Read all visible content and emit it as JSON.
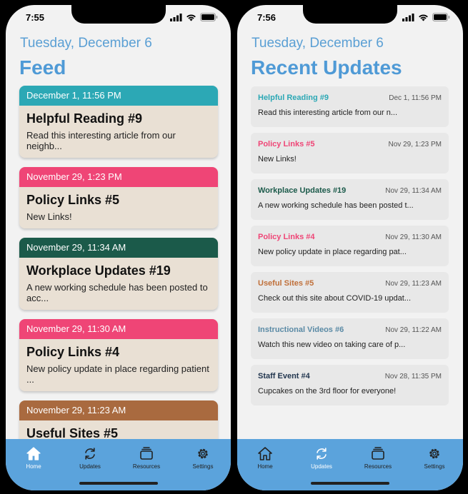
{
  "left": {
    "time": "7:55",
    "date": "Tuesday, December 6",
    "title": "Feed",
    "cards": [
      {
        "date": "December 1, 11:56 PM",
        "title": "Helpful Reading #9",
        "text": "Read this interesting article from our neighb...",
        "color": "#2ca8b5"
      },
      {
        "date": "November 29, 1:23 PM",
        "title": "Policy Links #5",
        "text": "New Links!",
        "color": "#ef4576"
      },
      {
        "date": "November 29, 11:34 AM",
        "title": "Workplace Updates #19",
        "text": "A new working schedule has been posted to acc...",
        "color": "#1b5a4a"
      },
      {
        "date": "November 29, 11:30 AM",
        "title": "Policy Links #4",
        "text": "New policy update in place regarding patient ...",
        "color": "#ef4576"
      },
      {
        "date": "November 29, 11:23 AM",
        "title": "Useful Sites #5",
        "text": "",
        "color": "#a96a3f"
      }
    ],
    "tabs": [
      "Home",
      "Updates",
      "Resources",
      "Settings"
    ]
  },
  "right": {
    "time": "7:56",
    "date": "Tuesday, December 6",
    "title": "Recent Updates",
    "items": [
      {
        "title": "Helpful Reading #9",
        "date": "Dec 1, 11:56 PM",
        "text": "Read this interesting article from our n...",
        "color": "#2ca8b5"
      },
      {
        "title": "Policy Links #5",
        "date": "Nov 29, 1:23 PM",
        "text": "New Links!",
        "color": "#ef4576"
      },
      {
        "title": "Workplace Updates #19",
        "date": "Nov 29, 11:34 AM",
        "text": "A new working schedule has been posted t...",
        "color": "#1b5a4a"
      },
      {
        "title": "Policy Links #4",
        "date": "Nov 29, 11:30 AM",
        "text": "New policy update in place regarding pat...",
        "color": "#ef4576"
      },
      {
        "title": "Useful Sites #5",
        "date": "Nov 29, 11:23 AM",
        "text": "Check out this site about COVID-19 updat...",
        "color": "#c0703a"
      },
      {
        "title": "Instructional Videos #6",
        "date": "Nov 29, 11:22 AM",
        "text": "Watch this new video on taking care of p...",
        "color": "#5a8aa5"
      },
      {
        "title": "Staff Event #4",
        "date": "Nov 28, 11:35 PM",
        "text": "Cupcakes on the 3rd floor for everyone!",
        "color": "#22364f"
      }
    ],
    "tabs": [
      "Home",
      "Updates",
      "Resources",
      "Settings"
    ]
  },
  "icons": [
    "home-icon",
    "updates-icon",
    "resources-icon",
    "settings-icon",
    "signal-icon",
    "wifi-icon",
    "battery-icon"
  ],
  "colors": {
    "accent": "#4f9ad6",
    "tabbar": "#5ba3dc",
    "active_tab": "#ffffff"
  }
}
